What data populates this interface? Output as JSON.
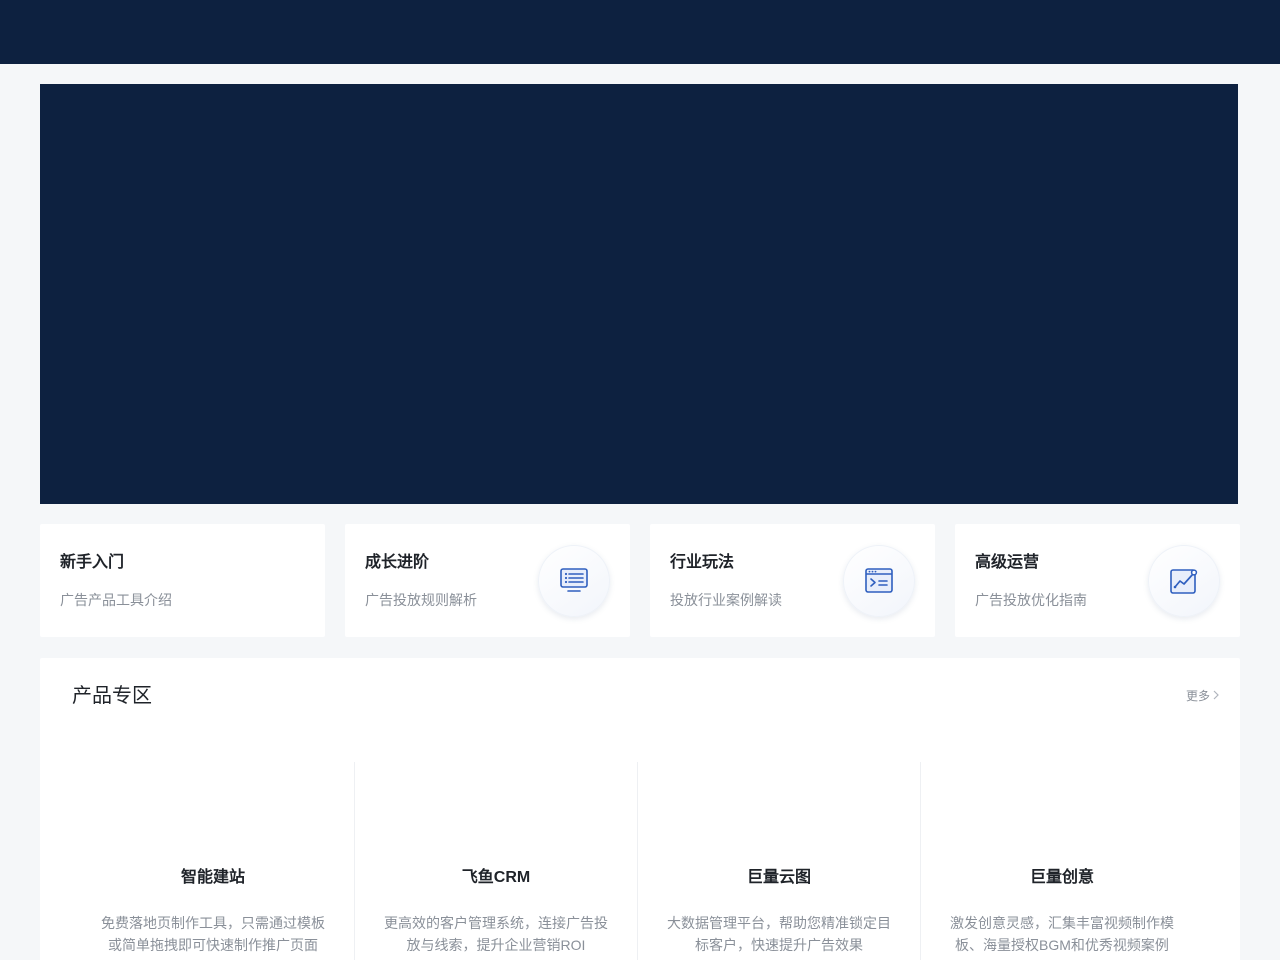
{
  "colors": {
    "navy": "#0d2140",
    "page_bg": "#f5f7f9",
    "card_bg": "#ffffff",
    "muted_text": "#8a9099",
    "icon_blue": "#2f5fbf"
  },
  "quick_cards": [
    {
      "title": "新手入门",
      "desc": "广告产品工具介绍",
      "icon": ""
    },
    {
      "title": "成长进阶",
      "desc": "广告投放规则解析",
      "icon": "list-document-icon"
    },
    {
      "title": "行业玩法",
      "desc": "投放行业案例解读",
      "icon": "terminal-window-icon"
    },
    {
      "title": "高级运营",
      "desc": "广告投放优化指南",
      "icon": "trend-chart-icon"
    }
  ],
  "products": {
    "title": "产品专区",
    "more_label": "更多",
    "items": [
      {
        "title": "智能建站",
        "desc": "免费落地页制作工具，只需通过模板或简单拖拽即可快速制作推广页面"
      },
      {
        "title": "飞鱼CRM",
        "desc": "更高效的客户管理系统，连接广告投放与线索，提升企业营销ROI"
      },
      {
        "title": "巨量云图",
        "desc": "大数据管理平台，帮助您精准锁定目标客户，快速提升广告效果"
      },
      {
        "title": "巨量创意",
        "desc": "激发创意灵感，汇集丰富视频制作模板、海量授权BGM和优秀视频案例"
      }
    ]
  }
}
